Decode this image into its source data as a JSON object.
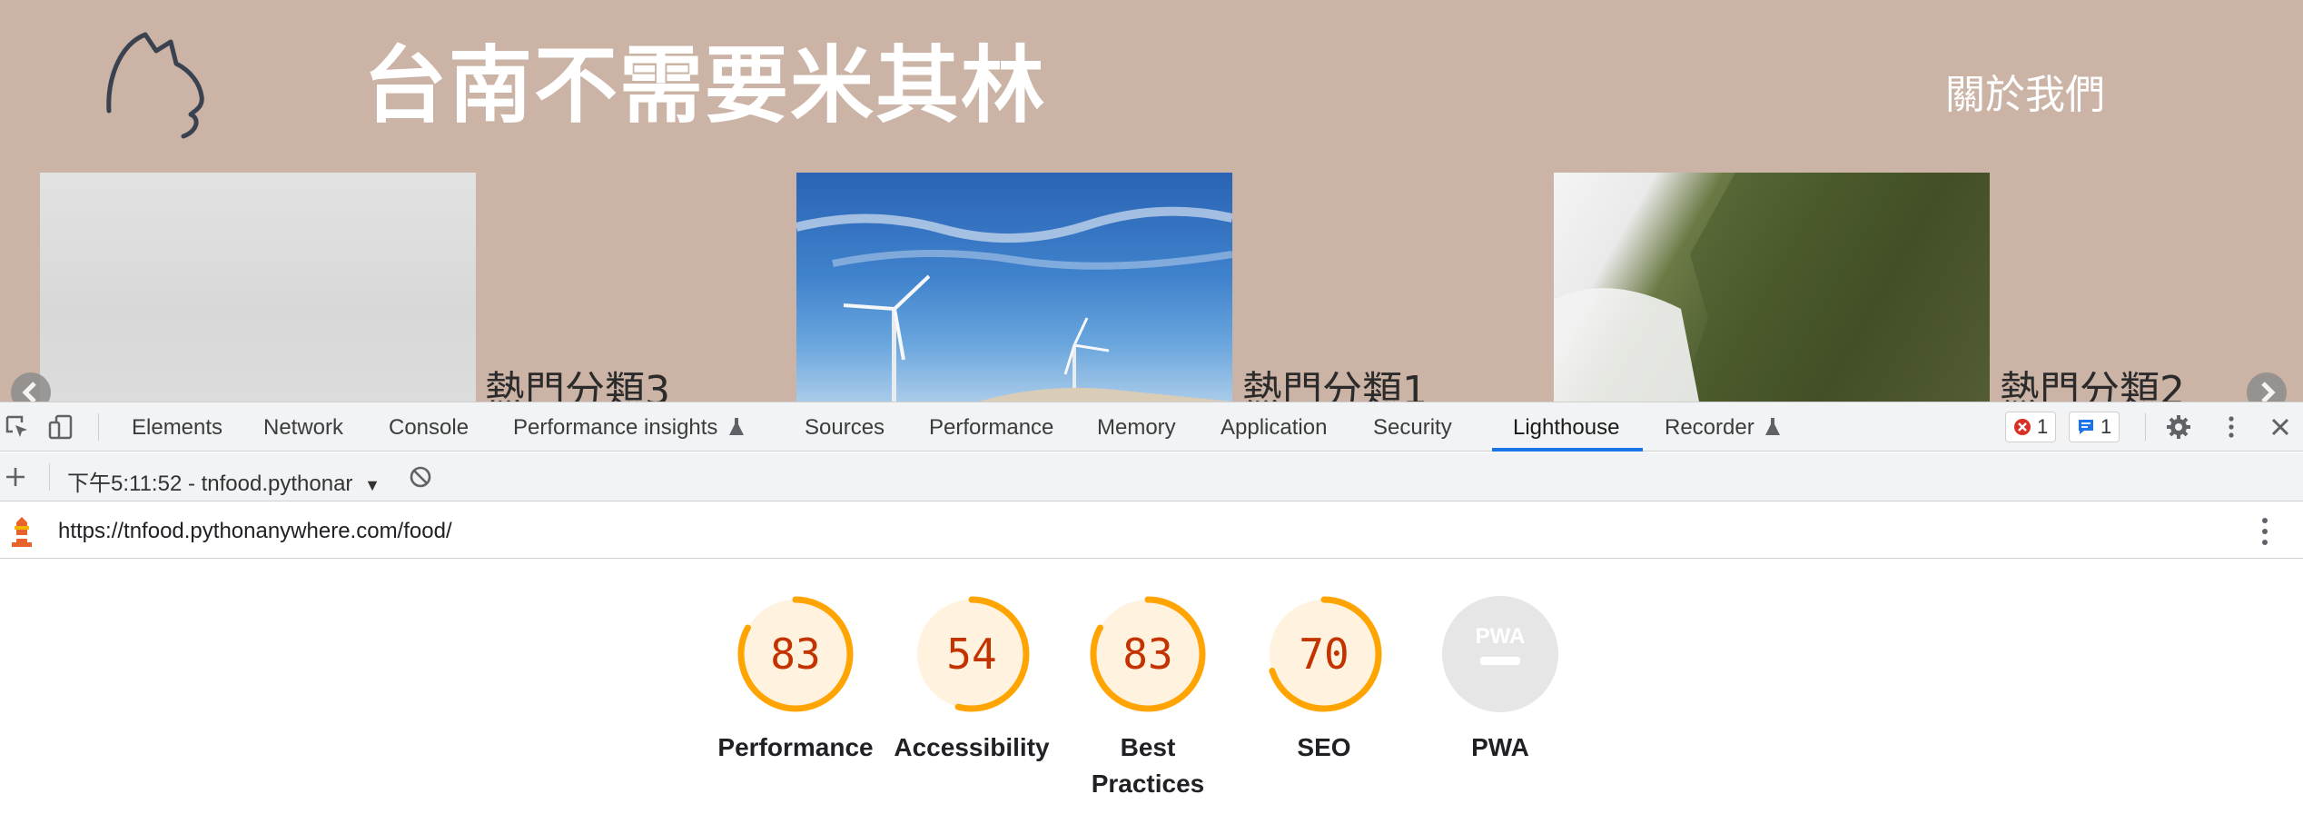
{
  "site": {
    "title": "台南不需要米其林",
    "about_link": "關於我們",
    "cards": [
      {
        "label": "熱門分類3"
      },
      {
        "label": "熱門分類1"
      },
      {
        "label": "熱門分類2"
      }
    ]
  },
  "devtools": {
    "tabs": [
      "Elements",
      "Network",
      "Console",
      "Performance insights",
      "Sources",
      "Performance",
      "Memory",
      "Application",
      "Security",
      "Lighthouse",
      "Recorder"
    ],
    "active_tab": "Lighthouse",
    "error_count": "1",
    "message_count": "1",
    "report_select": "下午5:11:52 - tnfood.pythonar",
    "url": "https://tnfood.pythonanywhere.com/food/",
    "categories": [
      {
        "score": "83",
        "value": 0.83,
        "label": "Performance"
      },
      {
        "score": "54",
        "value": 0.54,
        "label": "Accessibility"
      },
      {
        "score": "83",
        "value": 0.83,
        "label": "Best Practices"
      },
      {
        "score": "70",
        "value": 0.7,
        "label": "SEO"
      },
      {
        "score": "",
        "value": null,
        "label": "PWA",
        "badge": "PWA"
      }
    ],
    "colors": {
      "average": "#ffa400",
      "score_text": "#c33300",
      "accent": "#1a73e8"
    }
  }
}
